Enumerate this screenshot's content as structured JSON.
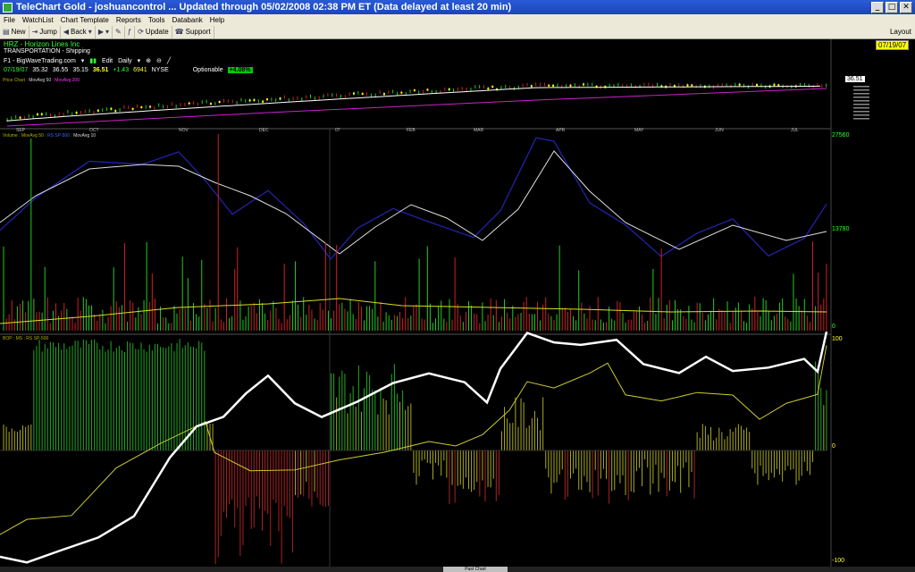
{
  "window": {
    "title": "TeleChart Gold - joshuancontrol ... Updated through 05/02/2008  02:38 PM ET  (Data delayed at least 20 min)",
    "minimize": "_",
    "maximize": "□",
    "close": "✕"
  },
  "menu": [
    "File",
    "WatchList",
    "Chart Template",
    "Reports",
    "Tools",
    "Databank",
    "Help"
  ],
  "toolbar": {
    "new": "New",
    "jump": "Jump",
    "back": "Back",
    "update": "Update",
    "support": "Support",
    "layout": "Layout",
    "date": "07/19/07"
  },
  "stock": {
    "ticker": "HRZ - Horizon Lines Inc",
    "industry": "TRANSPORTATION - Shipping",
    "watchlist": "F1 - BigWaveTrading.com",
    "edit": "Edit",
    "period": "Daily",
    "quote": {
      "date": "07/19/07",
      "open": "35.32",
      "high": "36.55",
      "low": "35.15",
      "last": "36.51",
      "change": "+1.43",
      "volume": "6941",
      "exchange": "NYSE",
      "optionable": "Optionable",
      "pct": "+4.08%"
    },
    "last_price_box": "36.51"
  },
  "panels": {
    "price_header": [
      "Price Chart",
      "MovAvg 50",
      "MovAvg 200"
    ],
    "volume_header": [
      "Volume",
      "MovAvg 50",
      "RS SP-500",
      "MovAvg 10"
    ],
    "bop_header": "BOP : MS : RS SP-500",
    "volume_axis_top": "27560",
    "volume_axis_mid": "13780",
    "volume_axis_bottom": "0",
    "bop_axis_top": "100",
    "bop_axis_mid": "0",
    "bop_axis_bottom": "-100"
  },
  "months": [
    "SEP",
    "OCT",
    "NOV",
    "DEC",
    "07",
    "FEB",
    "MAR",
    "APR",
    "MAY",
    "JUN",
    "JUL"
  ],
  "footer": {
    "past_chart": "Past Chart"
  },
  "colors": {
    "up": "#22cc22",
    "down": "#cc2222",
    "ma50": "#ffffff",
    "ma200": "#cc22cc",
    "rs_line": "#2222aa",
    "vol_ma": "#dddd22",
    "bop_pos": "#22aa22",
    "bop_neg": "#aa2222",
    "ms_line": "#ffffff",
    "rs_bop": "#cccc33"
  }
}
